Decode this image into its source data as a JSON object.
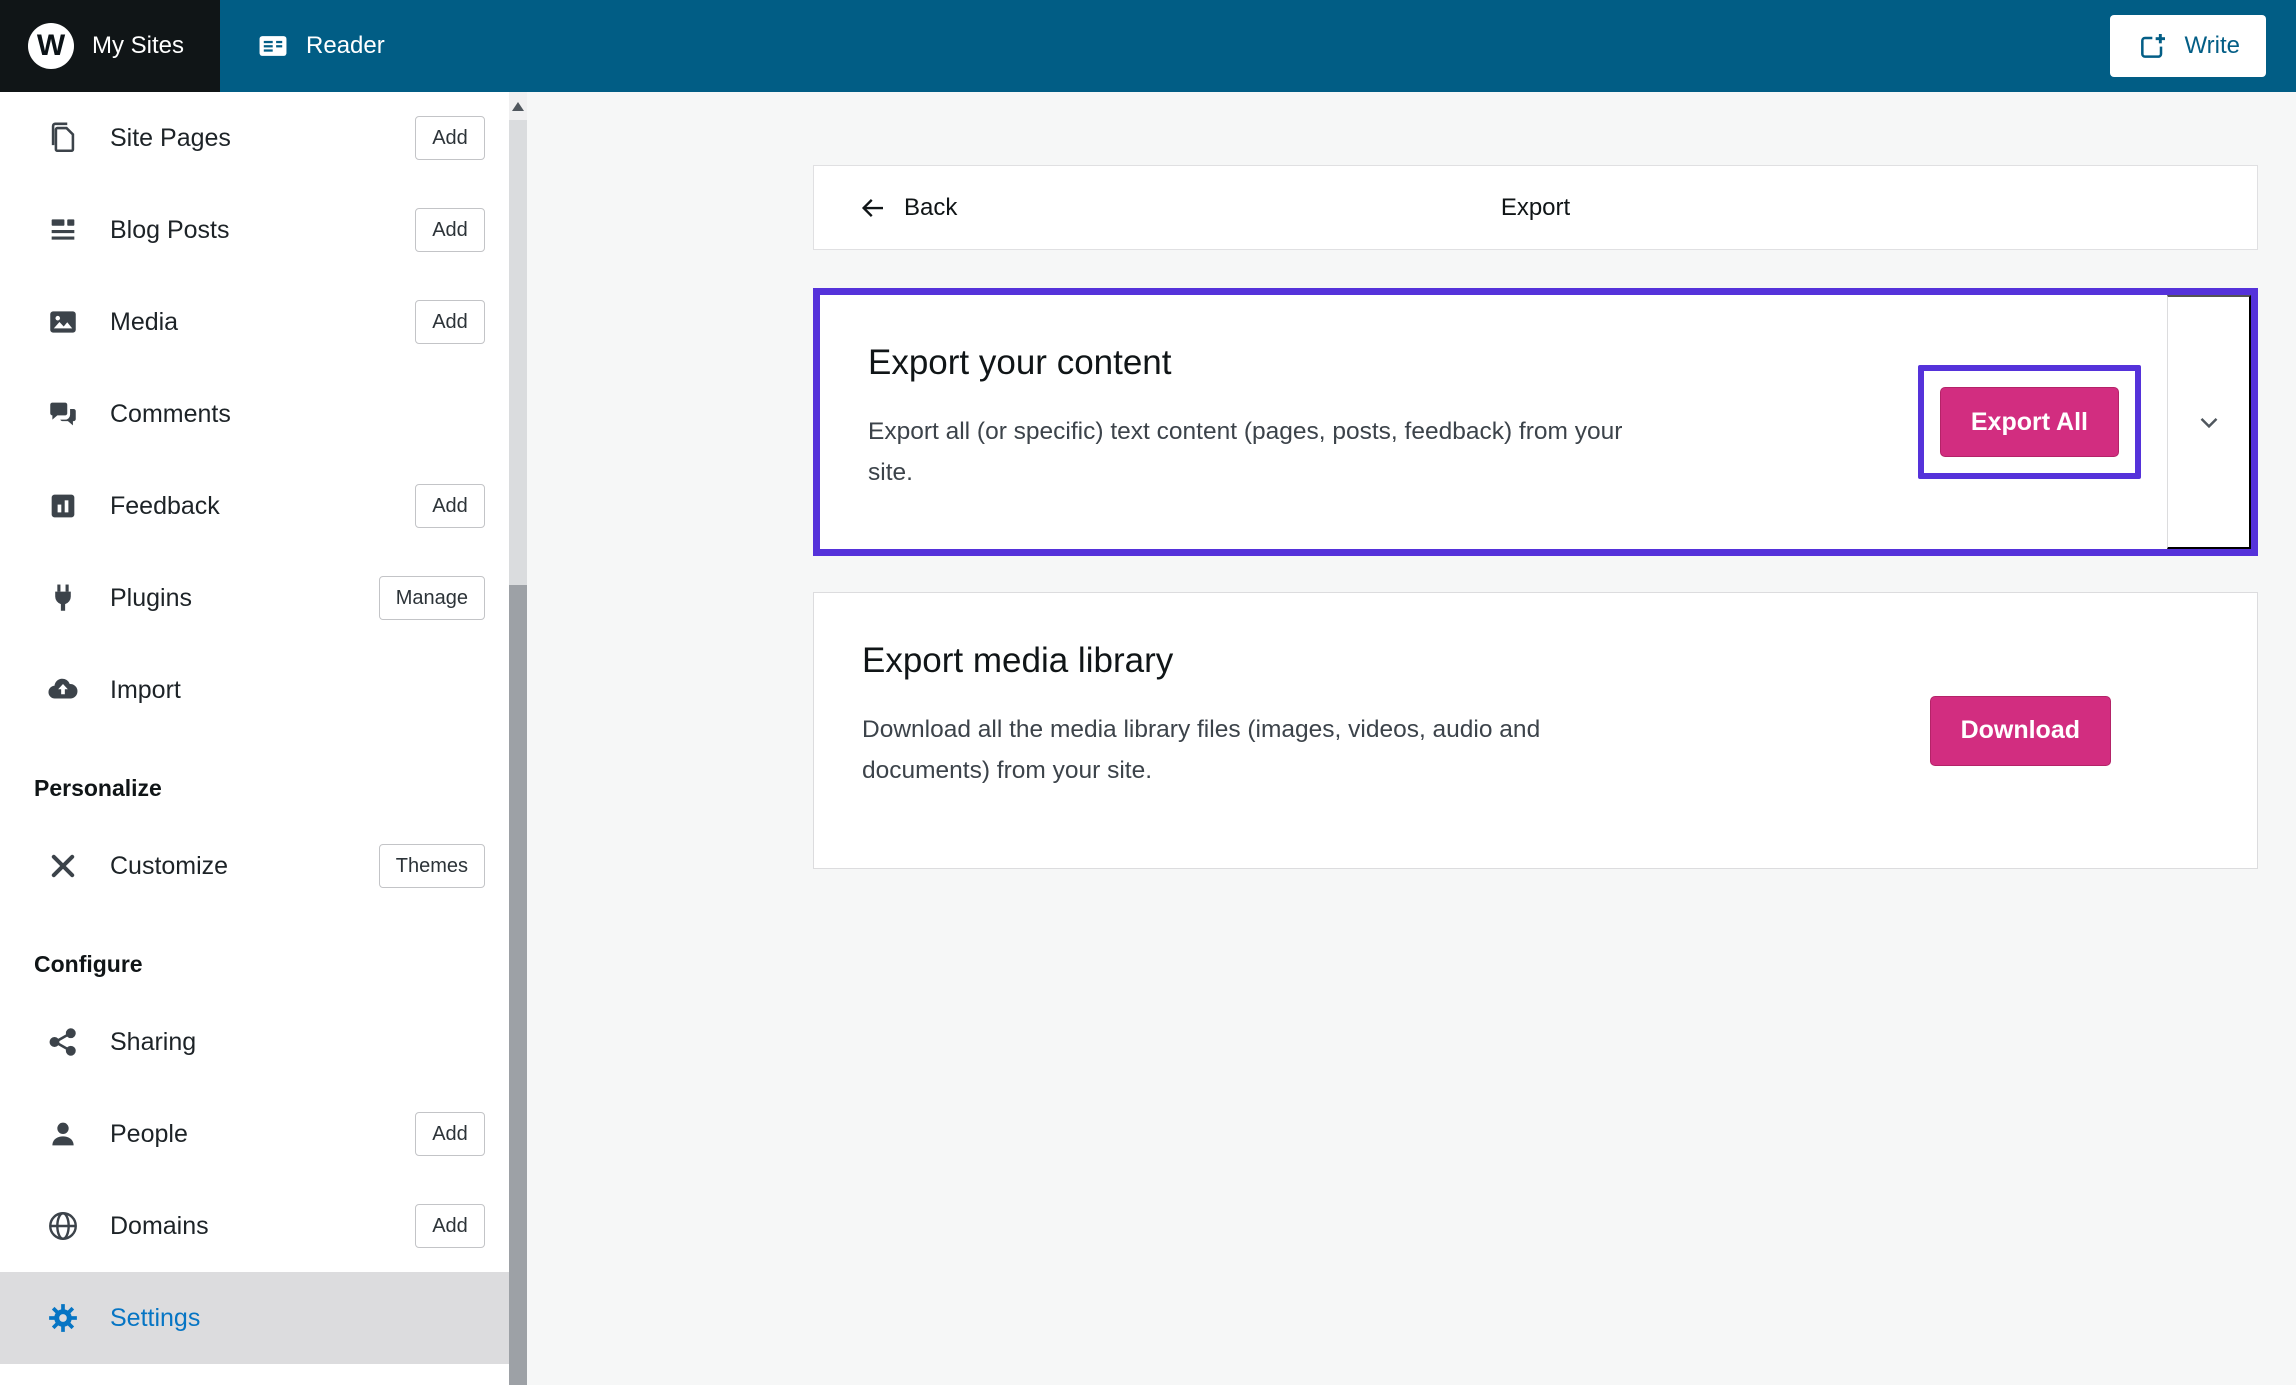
{
  "colors": {
    "masthead_bg": "#015d85",
    "masthead_dark": "#101517",
    "accent_pink": "#d22d80",
    "annotation_purple": "#5532da",
    "selected_blue": "#0675c4"
  },
  "masthead": {
    "my_sites_label": "My Sites",
    "reader_label": "Reader",
    "write_label": "Write"
  },
  "sidebar": {
    "items": [
      {
        "label": "Site Pages",
        "action": "Add"
      },
      {
        "label": "Blog Posts",
        "action": "Add"
      },
      {
        "label": "Media",
        "action": "Add"
      },
      {
        "label": "Comments"
      },
      {
        "label": "Feedback",
        "action": "Add"
      },
      {
        "label": "Plugins",
        "action": "Manage"
      },
      {
        "label": "Import"
      },
      {
        "label": "Customize",
        "action": "Themes"
      },
      {
        "label": "Sharing"
      },
      {
        "label": "People",
        "action": "Add"
      },
      {
        "label": "Domains",
        "action": "Add"
      },
      {
        "label": "Settings"
      }
    ],
    "section_personalize": "Personalize",
    "section_configure": "Configure"
  },
  "main": {
    "back_label": "Back",
    "page_title": "Export",
    "export_content": {
      "title": "Export your content",
      "description": "Export all (or specific) text content (pages, posts, feedback) from your\nsite.",
      "button_label": "Export All"
    },
    "export_media": {
      "title": "Export media library",
      "description": "Download all the media library files (images, videos, audio and\ndocuments) from your site.",
      "button_label": "Download"
    }
  }
}
